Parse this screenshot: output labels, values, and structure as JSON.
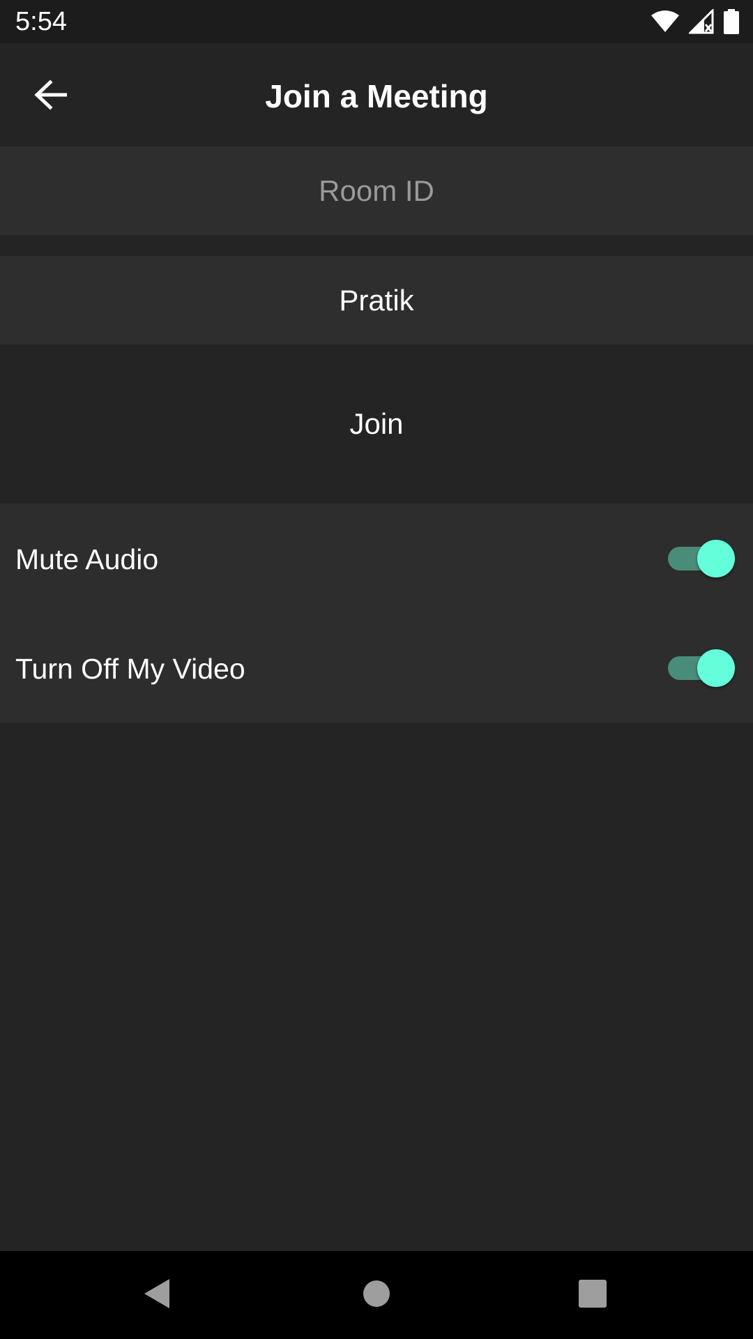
{
  "status_bar": {
    "time": "5:54",
    "icons": [
      "wifi-icon",
      "cell-signal-icon",
      "battery-icon"
    ]
  },
  "app_bar": {
    "title": "Join a Meeting",
    "back_icon": "arrow-left-icon"
  },
  "form": {
    "room_id": {
      "value": "",
      "placeholder": "Room ID"
    },
    "name": {
      "value": "Pratik"
    },
    "join_label": "Join"
  },
  "options": {
    "mute_audio": {
      "label": "Mute Audio",
      "enabled": true
    },
    "turn_off_video": {
      "label": "Turn Off My Video",
      "enabled": true
    }
  },
  "nav_bar": {
    "icons": [
      "back-triangle-icon",
      "home-circle-icon",
      "recents-square-icon"
    ]
  },
  "colors": {
    "background": "#242424",
    "input_background": "#2e2e2e",
    "options_background": "#2d2d2d",
    "switch_thumb": "#64ffda",
    "switch_track": "#4a8c7a",
    "placeholder": "#9a9a9a"
  }
}
